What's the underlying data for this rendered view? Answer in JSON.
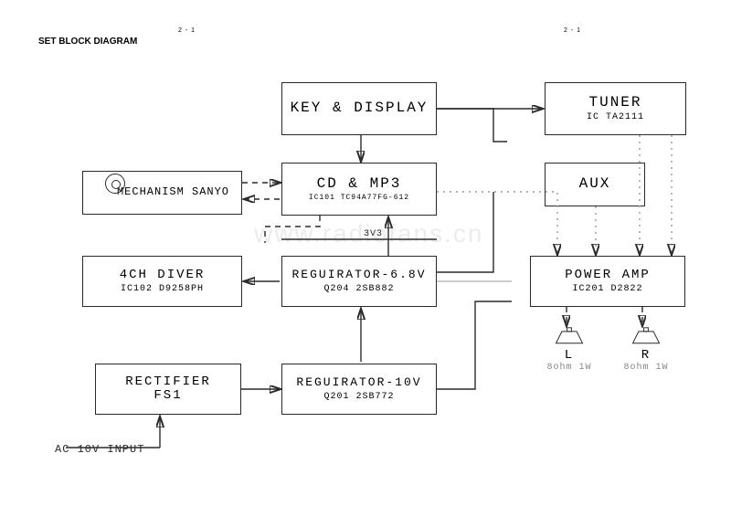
{
  "header": {
    "title": "SET BLOCK DIAGRAM",
    "page_top_left": "2 - 1",
    "page_top_right": "2 - 1"
  },
  "watermark": "www.radiofans.cn",
  "blocks": {
    "key_display": {
      "title": "KEY & DISPLAY"
    },
    "tuner": {
      "title": "TUNER",
      "sub": "IC TA2111"
    },
    "mechanism": {
      "title": "MECHANISM SANYO"
    },
    "cd_mp3": {
      "title": "CD & MP3",
      "sub": "IC101 TC94A77FG-612"
    },
    "aux": {
      "title": "AUX"
    },
    "diver": {
      "title": "4CH DIVER",
      "sub": "IC102 D9258PH"
    },
    "reg68": {
      "title": "REGUIRATOR-6.8V",
      "sub": "Q204 2SB882"
    },
    "poweramp": {
      "title": "POWER AMP",
      "sub": "IC201 D2822"
    },
    "rectifier": {
      "title": "RECTIFIER",
      "sub": "FS1"
    },
    "reg10": {
      "title": "REGUIRATOR-10V",
      "sub": "Q201 2SB772"
    }
  },
  "labels": {
    "v3v3": "3V3",
    "ac_input": "AC 10V INPUT"
  },
  "speakers": {
    "left": {
      "channel": "L",
      "spec": "8ohm 1W"
    },
    "right": {
      "channel": "R",
      "spec": "8ohm 1W"
    }
  }
}
